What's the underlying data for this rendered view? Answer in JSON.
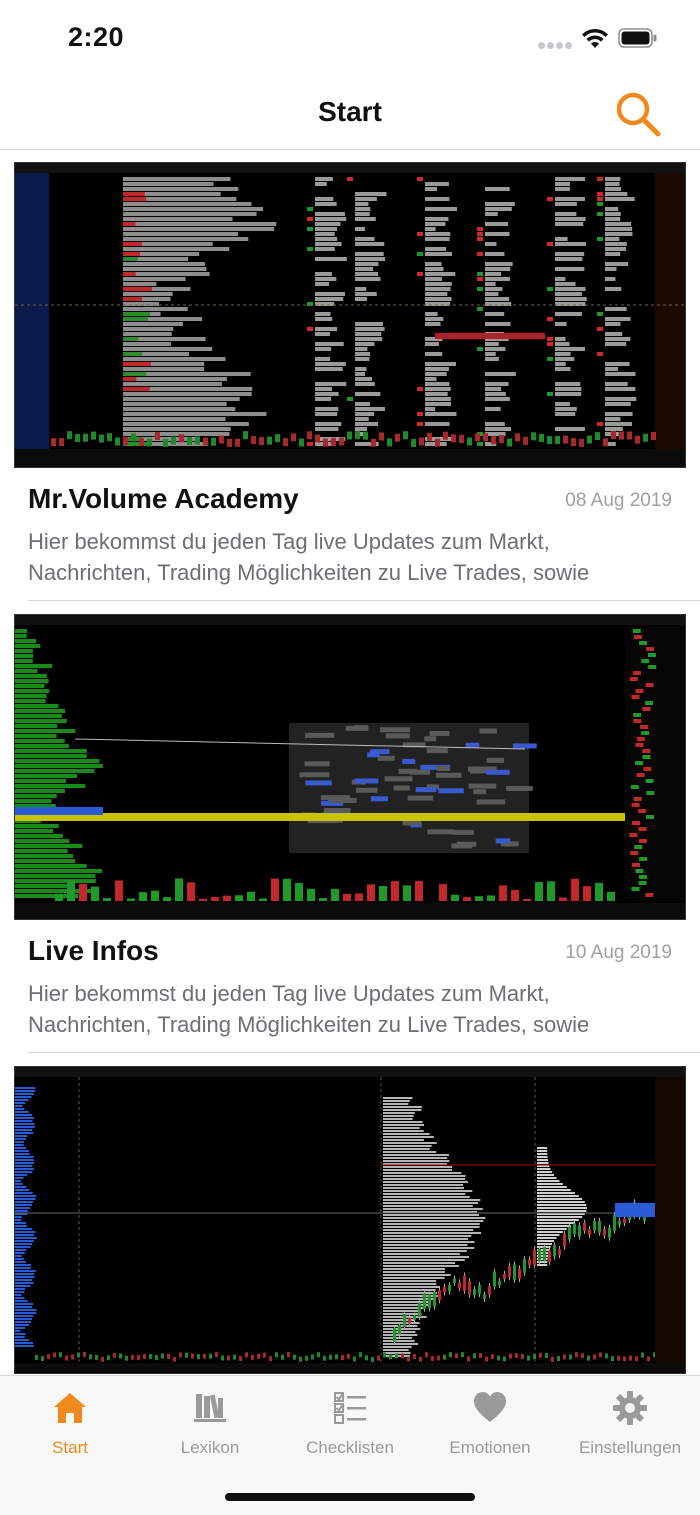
{
  "status_bar": {
    "time": "2:20"
  },
  "nav": {
    "title": "Start"
  },
  "feed": {
    "items": [
      {
        "title": "Mr.Volume Academy",
        "date": "08 Aug 2019",
        "excerpt": "Hier bekommst du jeden Tag live Updates zum Markt, Nachrichten, Trading Möglichkeiten zu Live Trades, sowie"
      },
      {
        "title": "Live Infos",
        "date": "10 Aug 2019",
        "excerpt": "Hier bekommst du jeden Tag live Updates zum Markt, Nachrichten, Trading Möglichkeiten zu Live Trades, sowie"
      },
      {}
    ]
  },
  "tabs": [
    {
      "label": "Start",
      "icon": "home-icon",
      "active": true
    },
    {
      "label": "Lexikon",
      "icon": "books-icon",
      "active": false
    },
    {
      "label": "Checklisten",
      "icon": "checklist-icon",
      "active": false
    },
    {
      "label": "Emotionen",
      "icon": "heart-icon",
      "active": false
    },
    {
      "label": "Einstellungen",
      "icon": "gear-icon",
      "active": false
    }
  ],
  "colors": {
    "accent": "#f08a1c",
    "inactive": "#9a9a9a",
    "chart_bg": "#000000"
  }
}
